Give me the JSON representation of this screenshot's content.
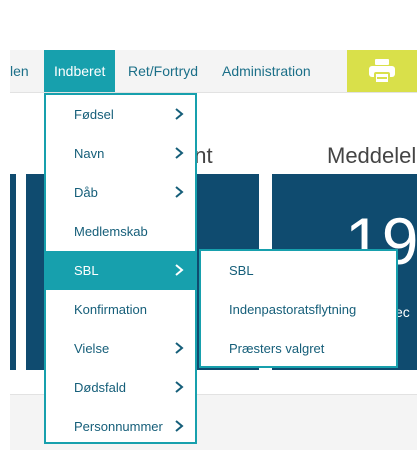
{
  "navbar": {
    "partial_left": "len",
    "active": "Indberet",
    "ret": "Ret/Fortryd",
    "admin": "Administration",
    "print_icon": "printer-icon"
  },
  "content": {
    "title_left_partial": "ent",
    "title_right_partial": "Meddelel",
    "big_number_partial": "19",
    "tile_sub_partial": "kec"
  },
  "menu": {
    "items": [
      {
        "label": "Fødsel",
        "submenu": true
      },
      {
        "label": "Navn",
        "submenu": true
      },
      {
        "label": "Dåb",
        "submenu": true
      },
      {
        "label": "Medlemskab",
        "submenu": false
      },
      {
        "label": "SBL",
        "submenu": true,
        "active": true
      },
      {
        "label": "Konfirmation",
        "submenu": false
      },
      {
        "label": "Vielse",
        "submenu": true
      },
      {
        "label": "Dødsfald",
        "submenu": true
      },
      {
        "label": "Personnummer",
        "submenu": true
      }
    ]
  },
  "submenu": {
    "items": [
      "SBL",
      "Indenpastoratsflytning",
      "Præsters valgret"
    ]
  },
  "colors": {
    "accent": "#17a0ad",
    "nav_link": "#1b6f88",
    "tile": "#0f4b6f",
    "print": "#d9e04a"
  }
}
